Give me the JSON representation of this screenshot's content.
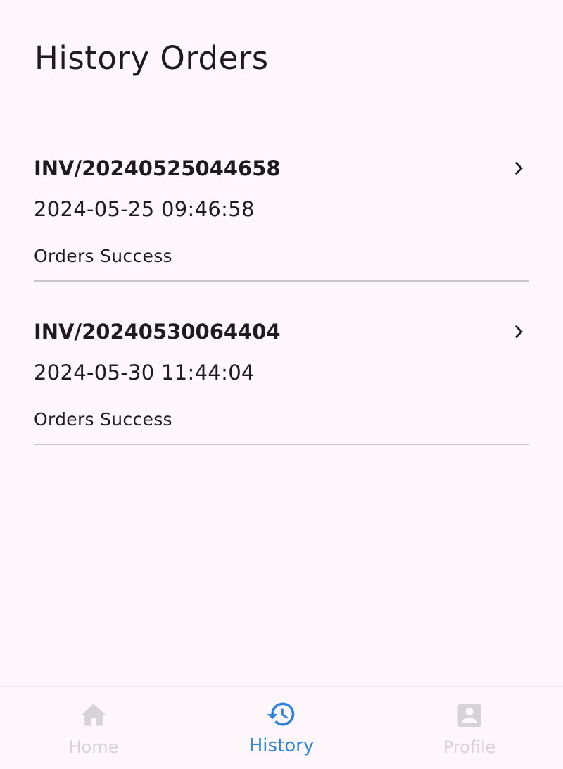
{
  "header": {
    "title": "History Orders"
  },
  "orders": [
    {
      "invoice": "INV/20240525044658",
      "date": "2024-05-25 09:46:58",
      "status": "Orders Success"
    },
    {
      "invoice": "INV/20240530064404",
      "date": "2024-05-30 11:44:04",
      "status": "Orders Success"
    }
  ],
  "bottom_nav": {
    "items": [
      {
        "label": "Home",
        "icon": "home-icon",
        "active": false
      },
      {
        "label": "History",
        "icon": "history-icon",
        "active": true
      },
      {
        "label": "Profile",
        "icon": "profile-icon",
        "active": false
      }
    ]
  },
  "colors": {
    "background": "#fdf7fc",
    "text": "#1d1b20",
    "accent": "#2f83d8",
    "inactive": "#d6d3d8",
    "divider": "#c9c5cc"
  }
}
